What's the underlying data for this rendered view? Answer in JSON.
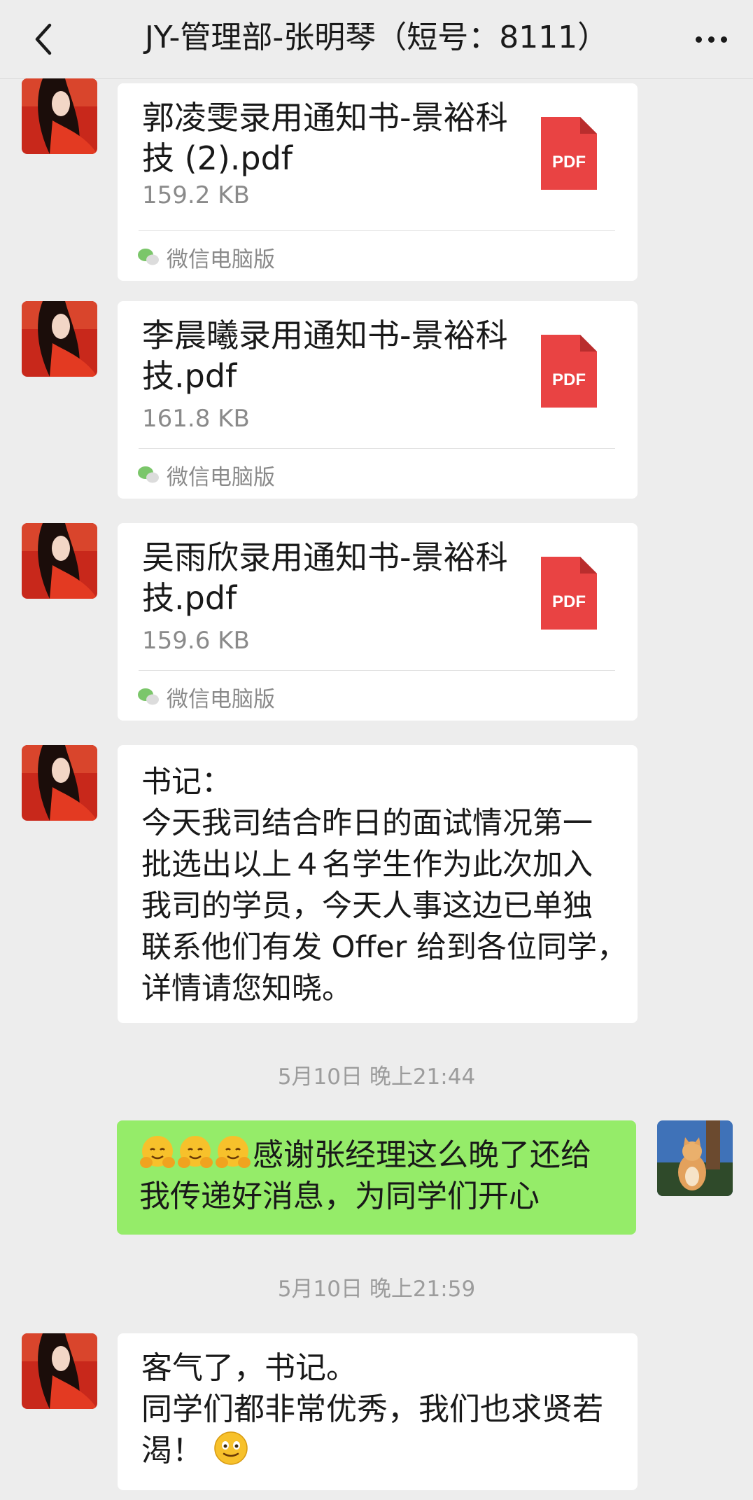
{
  "header": {
    "title": "JY-管理部-张明琴（短号：8111）",
    "back_icon": "chevron-left-icon",
    "more_icon": "more-dots-icon"
  },
  "messages": [
    {
      "type": "file",
      "sender": "other",
      "file_name_lines": [
        "郭凌雯录用通知书-景裕科",
        "技 (2).pdf"
      ],
      "file_size": "159.2 KB",
      "icon_label": "PDF",
      "source": "微信电脑版"
    },
    {
      "type": "file",
      "sender": "other",
      "file_name_lines": [
        "李晨曦录用通知书-景裕科",
        "技.pdf"
      ],
      "file_size": "161.8 KB",
      "icon_label": "PDF",
      "source": "微信电脑版"
    },
    {
      "type": "file",
      "sender": "other",
      "file_name_lines": [
        "吴雨欣录用通知书-景裕科",
        "技.pdf"
      ],
      "file_size": "159.6 KB",
      "icon_label": "PDF",
      "source": "微信电脑版"
    },
    {
      "type": "text",
      "sender": "other",
      "lines": [
        "书记：",
        "今天我司结合昨日的面试情况第一",
        "批选出以上４名学生作为此次加入",
        "我司的学员，今天人事这边已单独",
        "联系他们有发 Offer 给到各位同学，",
        "详情请您知晓。"
      ]
    },
    {
      "type": "time",
      "text": "5月10日 晚上21:44"
    },
    {
      "type": "text",
      "sender": "self",
      "lines": [
        "感谢张经理这么晚了还给",
        "我传递好消息，为同学们开心"
      ],
      "emoji": "hug-emoji"
    },
    {
      "type": "time",
      "text": "5月10日 晚上21:59"
    },
    {
      "type": "text",
      "sender": "other",
      "lines": [
        "客气了，书记。",
        "同学们都非常优秀，我们也求贤若",
        "渴！"
      ],
      "emoji": "smile-emoji"
    }
  ],
  "colors": {
    "background": "#ededed",
    "self_bubble": "#95ec69",
    "pdf_red": "#e94343"
  }
}
